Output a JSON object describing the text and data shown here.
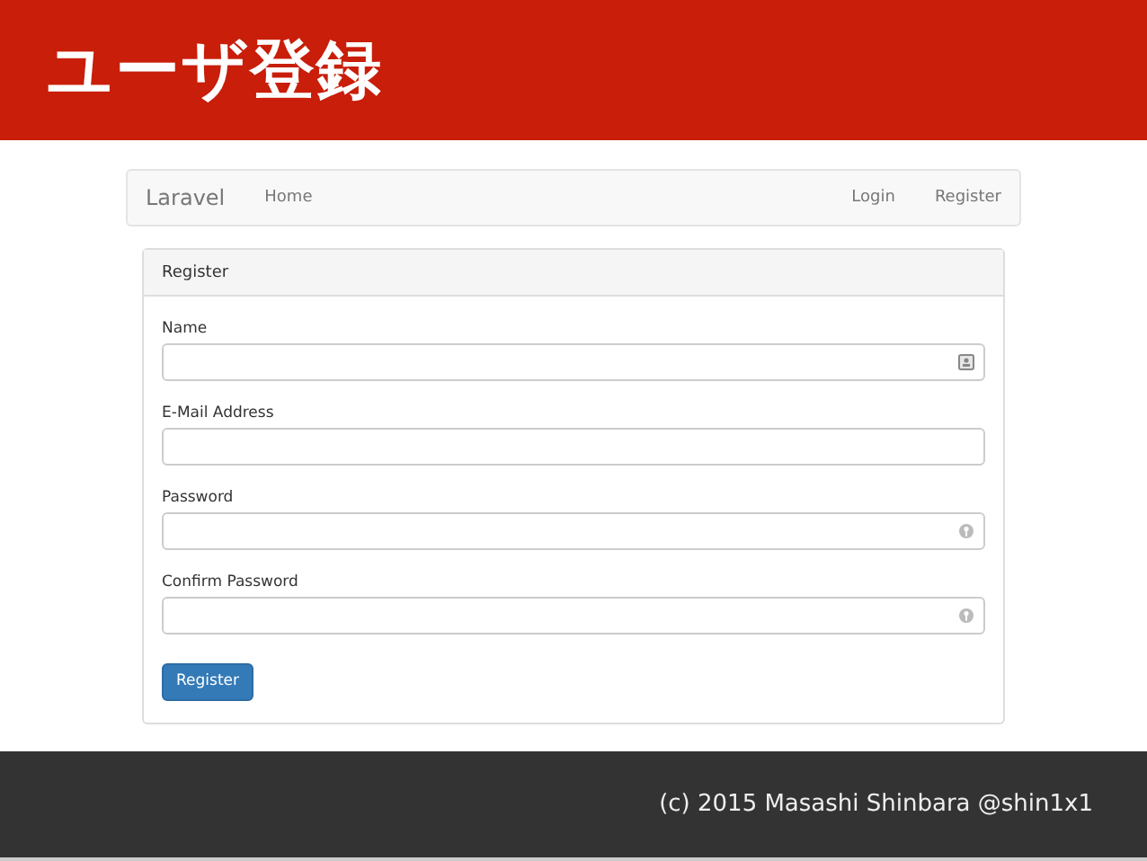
{
  "slide_title": "ユーザ登録",
  "navbar": {
    "brand": "Laravel",
    "left_links": [
      "Home"
    ],
    "right_links": [
      "Login",
      "Register"
    ]
  },
  "panel": {
    "heading": "Register",
    "fields": [
      {
        "label": "Name",
        "kind": "contact"
      },
      {
        "label": "E-Mail Address",
        "kind": "plain"
      },
      {
        "label": "Password",
        "kind": "secret"
      },
      {
        "label": "Confirm Password",
        "kind": "secret"
      }
    ],
    "submit": "Register"
  },
  "footer": "(c) 2015 Masashi Shinbara @shin1x1"
}
